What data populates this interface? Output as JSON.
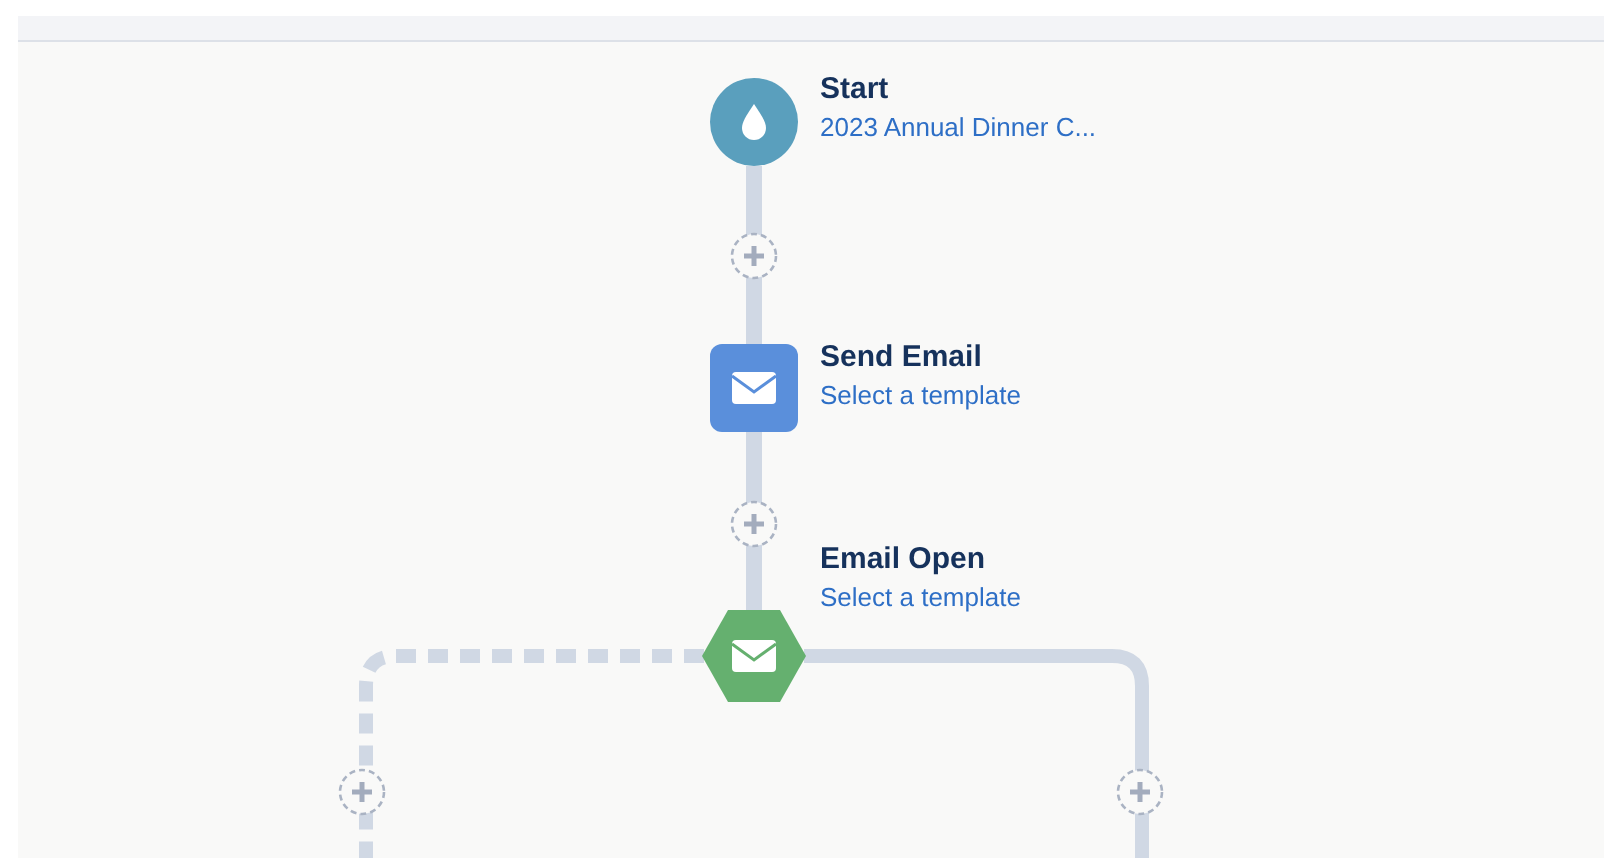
{
  "flow": {
    "nodes": [
      {
        "kind": "start",
        "title": "Start",
        "subtitle": "2023 Annual Dinner C..."
      },
      {
        "kind": "email",
        "title": "Send Email",
        "subtitle": "Select a template"
      },
      {
        "kind": "decision",
        "title": "Email Open",
        "subtitle": "Select a template"
      }
    ]
  }
}
